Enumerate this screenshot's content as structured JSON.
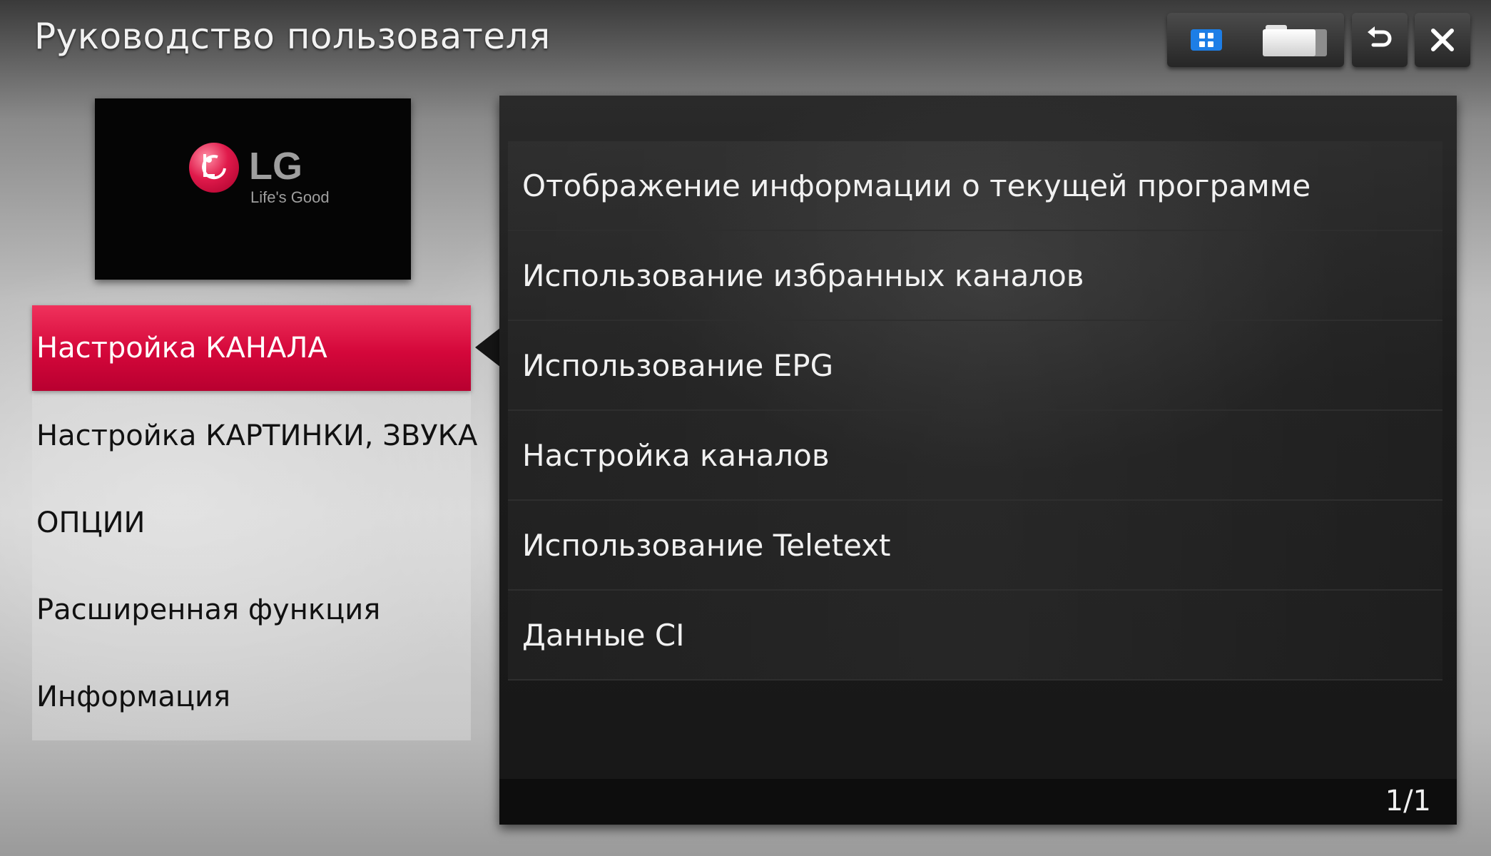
{
  "header": {
    "title": "Руководство пользователя"
  },
  "toolbar": {
    "icons": [
      "apps-icon",
      "folder-icon",
      "back-icon",
      "close-icon"
    ],
    "accent_color": "#1d7ee6"
  },
  "logo": {
    "brand": "LG",
    "slogan": "Life's Good"
  },
  "sidebar": {
    "active_index": 0,
    "active_color": "#d4073a",
    "items": [
      {
        "label": "Настройка КАНАЛА"
      },
      {
        "label": "Настройка КАРТИНКИ, ЗВУКА"
      },
      {
        "label": "ОПЦИИ"
      },
      {
        "label": "Расширенная функция"
      },
      {
        "label": "Информация"
      }
    ]
  },
  "content": {
    "items": [
      {
        "label": "Отображение информации о текущей программе"
      },
      {
        "label": "Использование избранных каналов"
      },
      {
        "label": "Использование EPG"
      },
      {
        "label": "Настройка каналов"
      },
      {
        "label": "Использование Teletext"
      },
      {
        "label": "Данные CI"
      }
    ],
    "page_indicator": "1/1"
  }
}
